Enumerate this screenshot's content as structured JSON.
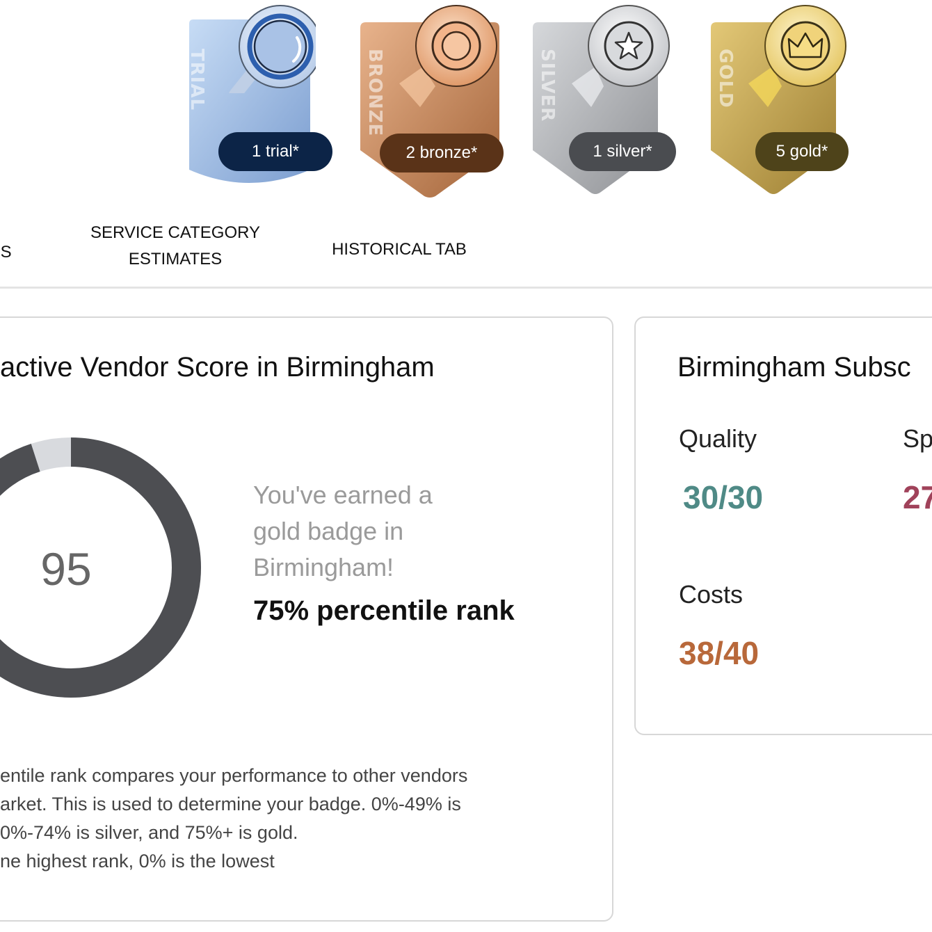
{
  "badges": [
    {
      "name": "trial",
      "side_label": "TRIAL",
      "count_label": "1 trial*",
      "icon": "magnifier-icon",
      "color": "#8fb0dc",
      "pill_color": "#0c2447"
    },
    {
      "name": "bronze",
      "side_label": "BRONZE",
      "count_label": "2 bronze*",
      "icon": "bronze-medal-icon",
      "color": "#c98a5e",
      "pill_color": "#5a3318"
    },
    {
      "name": "silver",
      "side_label": "SILVER",
      "count_label": "1 silver*",
      "icon": "star-medal-icon",
      "color": "#a7a9ad",
      "pill_color": "#4a4c50"
    },
    {
      "name": "gold",
      "side_label": "GOLD",
      "count_label": "5 gold*",
      "icon": "crown-medal-icon",
      "color": "#c9a84a",
      "pill_color": "#4e431a"
    }
  ],
  "tabs": [
    {
      "label": "DS"
    },
    {
      "label": "SERVICE CATEGORY ESTIMATES"
    },
    {
      "label": "HISTORICAL TAB"
    }
  ],
  "score_card": {
    "title": "active Vendor Score in Birmingham",
    "score": "95",
    "score_fraction": 0.95,
    "earned_text": "You've earned a gold badge in Birmingham!",
    "rank_text": "75% percentile rank",
    "note_lines": [
      "entile rank compares your performance to other vendors",
      "arket. This is used to determine your badge. 0%-49% is",
      "0%-74% is silver, and 75%+ is gold.",
      "ne highest rank, 0% is the lowest"
    ],
    "ring_color": "#4d4e52",
    "track_color": "#d8dade"
  },
  "subscore_card": {
    "title": "Birmingham Subsc",
    "metrics": [
      {
        "label": "Quality",
        "value": "30/30",
        "color": "#4f8a86"
      },
      {
        "label": "Sp",
        "value": "27",
        "color": "#a0425a"
      },
      {
        "label": "Costs",
        "value": "38/40",
        "color": "#b8683a"
      }
    ]
  }
}
